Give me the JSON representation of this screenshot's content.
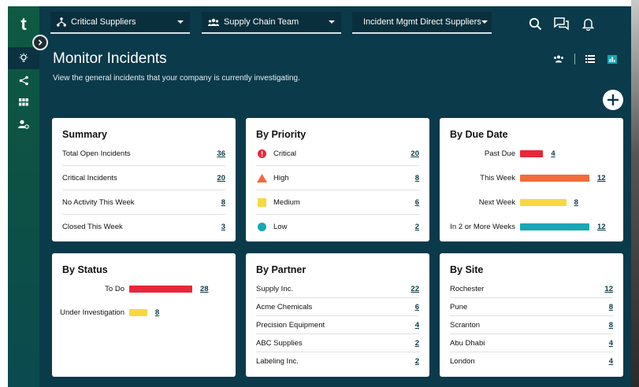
{
  "app": {
    "logo": "t"
  },
  "topbar": {
    "dropdowns": [
      {
        "label": "Critical Suppliers",
        "icon": "hierarchy-icon"
      },
      {
        "label": "Supply Chain Team",
        "icon": "team-icon"
      },
      {
        "label": "Incident Mgmt Direct Suppliers",
        "icon": "refresh-icon"
      }
    ],
    "icons": [
      "search-icon",
      "chat-icon",
      "bell-icon",
      "avatar"
    ]
  },
  "rail": {
    "items": [
      "lightbulb-icon",
      "share-icon",
      "grid-icon",
      "user-settings-icon"
    ]
  },
  "page": {
    "title": "Monitor Incidents",
    "subtitle": "View the general incidents that your company is currently investigating."
  },
  "summary": {
    "title": "Summary",
    "rows": [
      {
        "label": "Total Open Incidents",
        "value": "36"
      },
      {
        "label": "Critical Incidents",
        "value": "20"
      },
      {
        "label": "No Activity This Week",
        "value": "8"
      },
      {
        "label": "Closed This Week",
        "value": "3"
      }
    ]
  },
  "priority": {
    "title": "By Priority",
    "rows": [
      {
        "label": "Critical",
        "value": "20",
        "icon": "critical-icon",
        "color": "#e8283a"
      },
      {
        "label": "High",
        "value": "8",
        "icon": "high-triangle-icon",
        "color": "#f26b3a"
      },
      {
        "label": "Medium",
        "value": "6",
        "icon": "medium-square-icon",
        "color": "#f7d842"
      },
      {
        "label": "Low",
        "value": "2",
        "icon": "low-circle-icon",
        "color": "#17a7b5"
      }
    ]
  },
  "due": {
    "title": "By Due Date",
    "max": 12,
    "rows": [
      {
        "label": "Past Due",
        "value": "4",
        "color": "#e8283a"
      },
      {
        "label": "This Week",
        "value": "12",
        "color": "#f26b3a"
      },
      {
        "label": "Next Week",
        "value": "8",
        "color": "#f7d842"
      },
      {
        "label": "In 2 or More Weeks",
        "value": "12",
        "color": "#17a7b5"
      }
    ]
  },
  "status": {
    "title": "By Status",
    "max": 28,
    "rows": [
      {
        "label": "To Do",
        "value": "28",
        "color": "#e8283a"
      },
      {
        "label": "Under Investigation",
        "value": "8",
        "color": "#f7d842"
      }
    ]
  },
  "partner": {
    "title": "By Partner",
    "rows": [
      {
        "label": "Supply Inc.",
        "value": "22"
      },
      {
        "label": "Acme Chemicals",
        "value": "6"
      },
      {
        "label": "Precision Equipment",
        "value": "4"
      },
      {
        "label": "ABC Supplies",
        "value": "2"
      },
      {
        "label": "Labeling Inc.",
        "value": "2"
      }
    ]
  },
  "site": {
    "title": "By Site",
    "rows": [
      {
        "label": "Rochester",
        "value": "12"
      },
      {
        "label": "Pune",
        "value": "8"
      },
      {
        "label": "Scranton",
        "value": "8"
      },
      {
        "label": "Abu Dhabi",
        "value": "4"
      },
      {
        "label": "London",
        "value": "4"
      }
    ]
  }
}
